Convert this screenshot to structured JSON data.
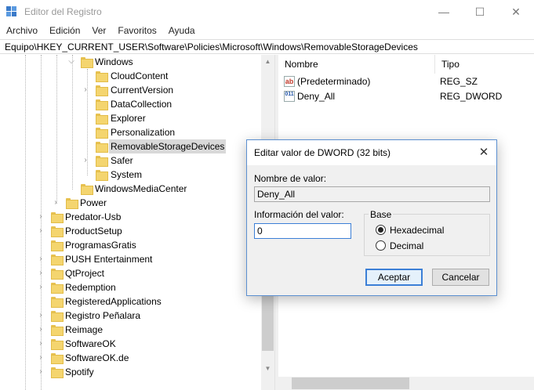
{
  "window": {
    "title": "Editor del Registro",
    "minimize_glyph": "—",
    "maximize_glyph": "☐",
    "close_glyph": "✕"
  },
  "menu": [
    "Archivo",
    "Edición",
    "Ver",
    "Favoritos",
    "Ayuda"
  ],
  "address": "Equipo\\HKEY_CURRENT_USER\\Software\\Policies\\Microsoft\\Windows\\RemovableStorageDevices",
  "tree": {
    "expanded_parent": "Windows",
    "children": [
      {
        "label": "CloudContent",
        "expandable": false
      },
      {
        "label": "CurrentVersion",
        "expandable": true
      },
      {
        "label": "DataCollection",
        "expandable": false
      },
      {
        "label": "Explorer",
        "expandable": false
      },
      {
        "label": "Personalization",
        "expandable": false
      },
      {
        "label": "RemovableStorageDevices",
        "expandable": false,
        "selected": true
      },
      {
        "label": "Safer",
        "expandable": true
      },
      {
        "label": "System",
        "expandable": false
      }
    ],
    "sibling": "WindowsMediaCenter",
    "power": "Power",
    "top_level": [
      "Predator-Usb",
      "ProductSetup",
      "ProgramasGratis",
      "PUSH Entertainment",
      "QtProject",
      "Redemption",
      "RegisteredApplications",
      "Registro Peñalara",
      "Reimage",
      "SoftwareOK",
      "SoftwareOK.de",
      "Spotify"
    ]
  },
  "list": {
    "columns": [
      "Nombre",
      "Tipo"
    ],
    "rows": [
      {
        "name": "(Predeterminado)",
        "type": "REG_SZ",
        "icon": "ab"
      },
      {
        "name": "Deny_All",
        "type": "REG_DWORD",
        "icon": "011"
      }
    ]
  },
  "dialog": {
    "title": "Editar valor de DWORD (32 bits)",
    "close_glyph": "✕",
    "value_name_label": "Nombre de valor:",
    "value_name": "Deny_All",
    "value_data_label": "Información del valor:",
    "value_data": "0",
    "base_label": "Base",
    "hex_label": "Hexadecimal",
    "dec_label": "Decimal",
    "selected_base": "Hexadecimal",
    "ok_label": "Aceptar",
    "cancel_label": "Cancelar"
  },
  "colors": {
    "folder": "#f4d56f",
    "accent": "#3c7fd6",
    "selection": "#d9d9d9"
  }
}
